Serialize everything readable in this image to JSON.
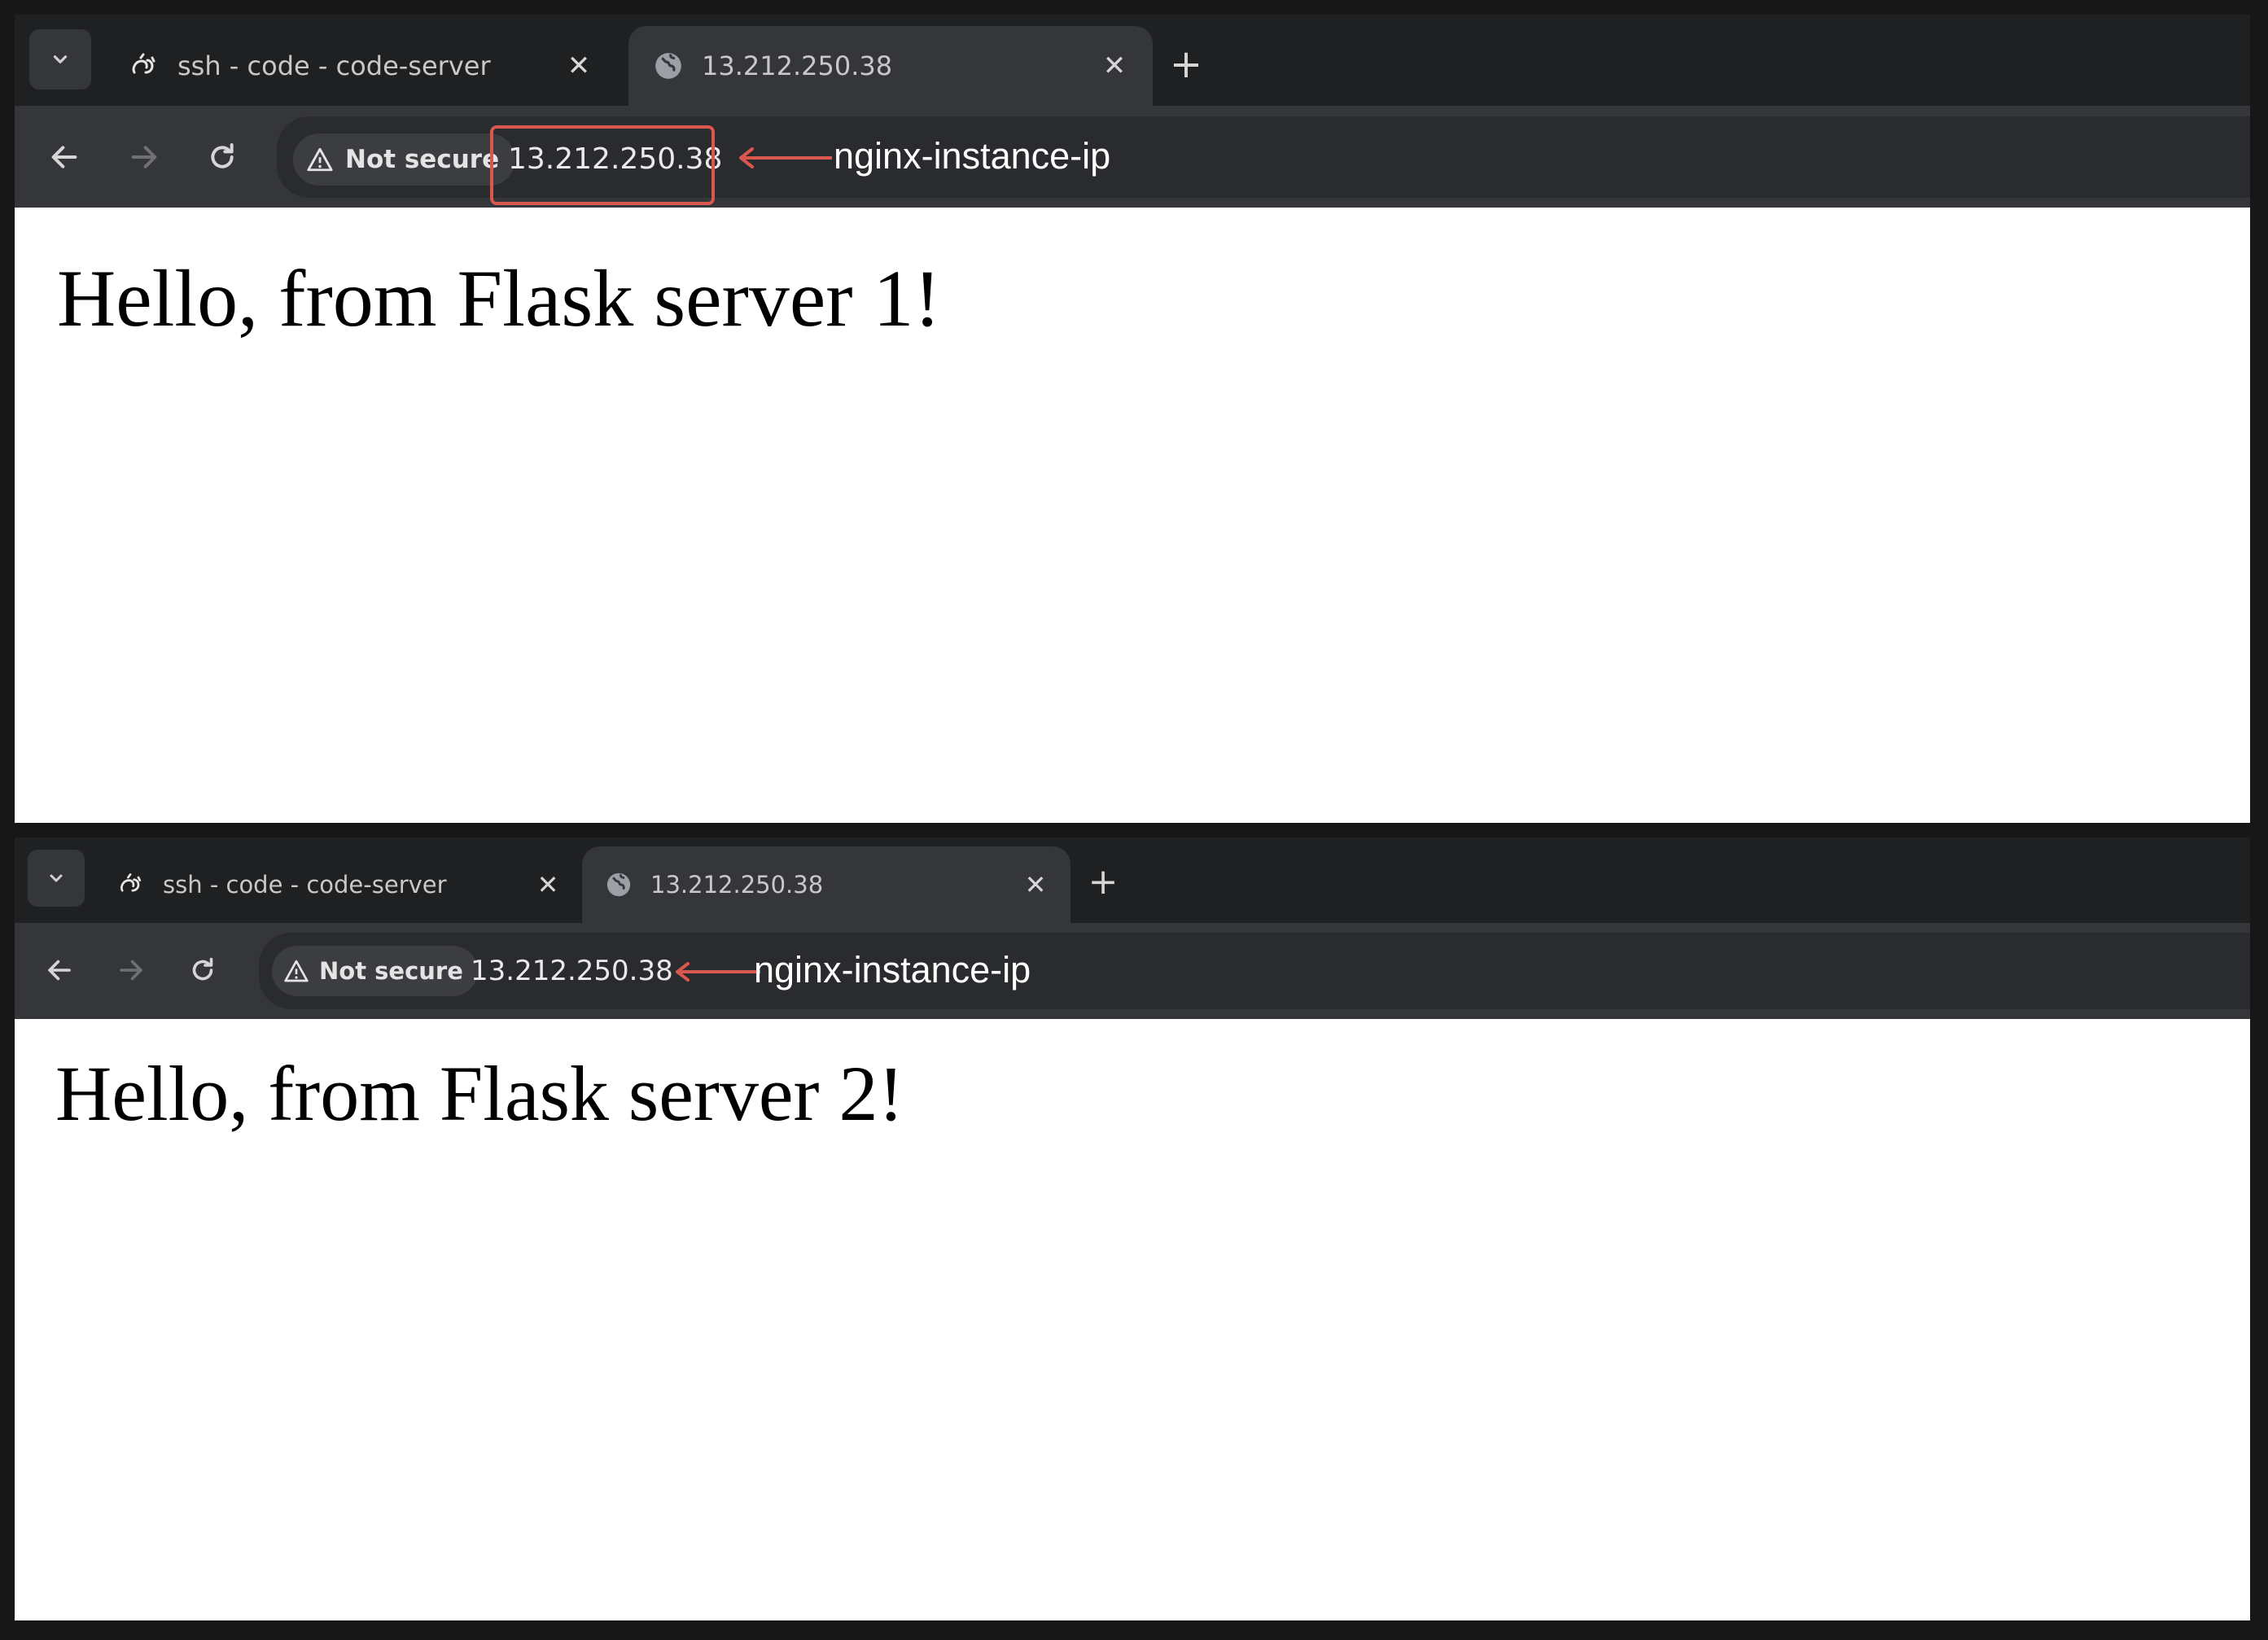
{
  "windows": [
    {
      "tabs": [
        {
          "title": "ssh - code - code-server",
          "icon": "code-server-icon",
          "active": false
        },
        {
          "title": "13.212.250.38",
          "icon": "globe-icon",
          "active": true
        }
      ],
      "security_chip": "Not secure",
      "url": "13.212.250.38",
      "annotation": "nginx-instance-ip",
      "heading": "Hello, from Flask server 1!"
    },
    {
      "tabs": [
        {
          "title": "ssh - code - code-server",
          "icon": "code-server-icon",
          "active": false
        },
        {
          "title": "13.212.250.38",
          "icon": "globe-icon",
          "active": true
        }
      ],
      "security_chip": "Not secure",
      "url": "13.212.250.38",
      "annotation": "nginx-instance-ip",
      "heading": "Hello, from Flask server 2!"
    }
  ],
  "colors": {
    "annotation_red": "#d9574e",
    "chrome_dark": "#202124",
    "active_tab": "#35363a"
  }
}
